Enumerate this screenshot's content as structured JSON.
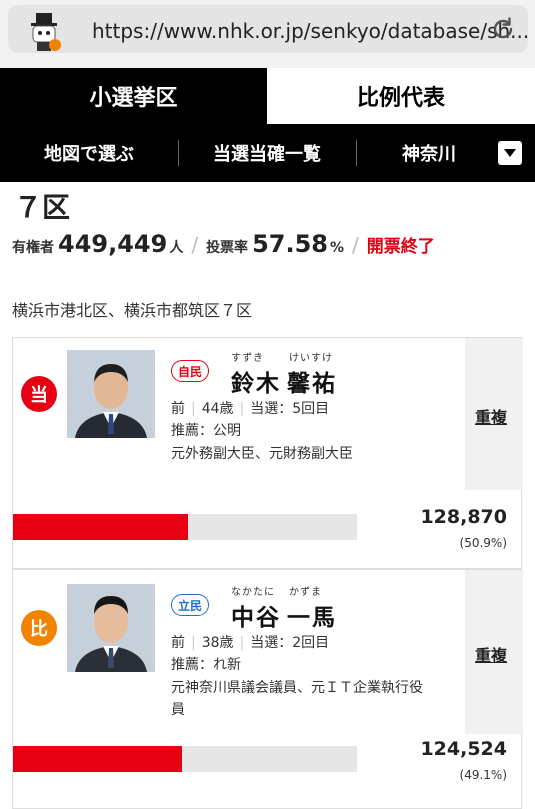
{
  "browser": {
    "url": "https://www.nhk.or.jp/senkyo/database/sh..."
  },
  "tabs": [
    {
      "label": "小選挙区",
      "active": true
    },
    {
      "label": "比例代表",
      "active": false
    }
  ],
  "subnav": {
    "map_label": "地図で選ぶ",
    "winners_label": "当選当確一覧",
    "prefecture": "神奈川"
  },
  "district": {
    "name": "７区",
    "voters_label": "有権者",
    "voters_value": "449,449",
    "voters_unit": "人",
    "turnout_label": "投票率",
    "turnout_value": "57.58",
    "turnout_unit": "%",
    "count_status": "開票終了",
    "area": "横浜市港北区、横浜市都筑区７区"
  },
  "candidates": [
    {
      "badge": "当",
      "badge_color": "#e60012",
      "party": "自民",
      "party_color": "#e60012",
      "ruby_family": "すずき",
      "ruby_given": "けいすけ",
      "name_family": "鈴木",
      "name_given": "馨祐",
      "status": "前",
      "age": "44歳",
      "elected": "当選：5回目",
      "recommend": "推薦：公明",
      "career": "元外務副大臣、元財務副大臣",
      "career2": "",
      "duplicate": "重複",
      "votes": "128,870",
      "percent": "(50.9%)",
      "share": 0.509
    },
    {
      "badge": "比",
      "badge_color": "#f08300",
      "party": "立民",
      "party_color": "#1e6fd1",
      "ruby_family": "なかたに",
      "ruby_given": "かずま",
      "name_family": "中谷",
      "name_given": "一馬",
      "status": "前",
      "age": "38歳",
      "elected": "当選：2回目",
      "recommend": "推薦：れ新",
      "career": "元神奈川県議会議員、元ＩＴ企業執行役",
      "career2": "員",
      "duplicate": "重複",
      "votes": "124,524",
      "percent": "(49.1%)",
      "share": 0.491
    }
  ],
  "colors": {
    "accent": "#e60012",
    "header_bg": "#000000"
  }
}
